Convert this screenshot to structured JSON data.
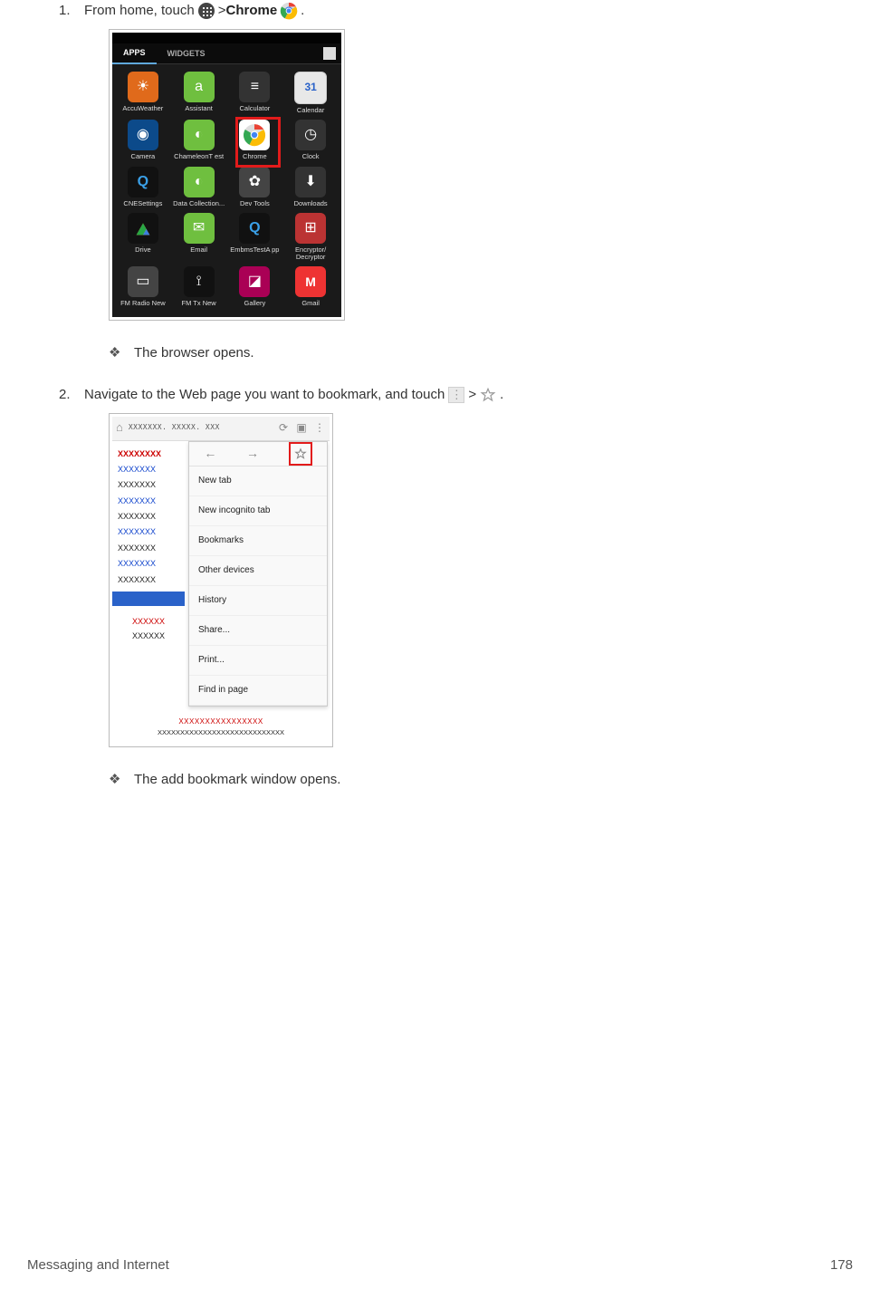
{
  "steps": {
    "s1": {
      "num": "1.",
      "pre": "From home, touch ",
      "post1": " > ",
      "bold": "Chrome",
      "post2": " ",
      "period": "."
    },
    "s2": {
      "num": "2.",
      "text_a": "Navigate to the Web page you want to bookmark, and touch ",
      "text_b": " > ",
      "text_c": "."
    }
  },
  "bullets": {
    "b1": "The browser opens.",
    "b2": "The add bookmark window opens."
  },
  "shot1": {
    "tabs": {
      "apps": "APPS",
      "widgets": "WIDGETS"
    },
    "apps": [
      {
        "label": "AccuWeather",
        "color": "#e06a1b",
        "glyph": "☀"
      },
      {
        "label": "Assistant",
        "color": "#6fbf3f",
        "glyph": "a"
      },
      {
        "label": "Calculator",
        "color": "#333",
        "glyph": "≡"
      },
      {
        "label": "Calendar",
        "color": "#e8e8e8",
        "glyph": "31"
      },
      {
        "label": "Camera",
        "color": "#0c4a8a",
        "glyph": "◉"
      },
      {
        "label": "ChameleonT est",
        "color": "#6fbf3f",
        "glyph": "◐"
      },
      {
        "label": "Chrome",
        "color": "#fff",
        "glyph": "chrome"
      },
      {
        "label": "Clock",
        "color": "#333",
        "glyph": "◷"
      },
      {
        "label": "CNESettings",
        "color": "#111",
        "glyph": "Q"
      },
      {
        "label": "Data Collection...",
        "color": "#6fbf3f",
        "glyph": "◐"
      },
      {
        "label": "Dev Tools",
        "color": "#444",
        "glyph": "✿"
      },
      {
        "label": "Downloads",
        "color": "#333",
        "glyph": "⬇"
      },
      {
        "label": "Drive",
        "color": "#111",
        "glyph": "▲"
      },
      {
        "label": "Email",
        "color": "#6fbf3f",
        "glyph": "✉"
      },
      {
        "label": "EmbmsTestA pp",
        "color": "#111",
        "glyph": "Q"
      },
      {
        "label": "Encryptor/ Decryptor",
        "color": "#b33",
        "glyph": "⊞"
      },
      {
        "label": "FM Radio New",
        "color": "#444",
        "glyph": "▭"
      },
      {
        "label": "FM Tx New",
        "color": "#111",
        "glyph": "⟟"
      },
      {
        "label": "Gallery",
        "color": "#a05",
        "glyph": "◪"
      },
      {
        "label": "Gmail",
        "color": "#e33",
        "glyph": "M"
      }
    ]
  },
  "shot2": {
    "url": "XXXXXXX. XXXXX. XXX",
    "left": {
      "h1": "XXXXXXXX",
      "pairs": [
        "XXXXXXX",
        "XXXXXXX",
        "XXXXXXX",
        "XXXXXXX",
        "XXXXXXX",
        "XXXXXXX",
        "XXXXXXX",
        "XXXXXXX"
      ],
      "cred": "XXXXXX",
      "cblk": "XXXXXX"
    },
    "menu": [
      "New tab",
      "New incognito tab",
      "Bookmarks",
      "Other devices",
      "History",
      "Share...",
      "Print...",
      "Find in page"
    ],
    "footer": {
      "red": "XXXXXXXXXXXXXXXX",
      "blk": "XXXXXXXXXXXXXXXXXXXXXXXXXXXX"
    }
  },
  "footer": {
    "section": "Messaging and Internet",
    "page": "178"
  }
}
